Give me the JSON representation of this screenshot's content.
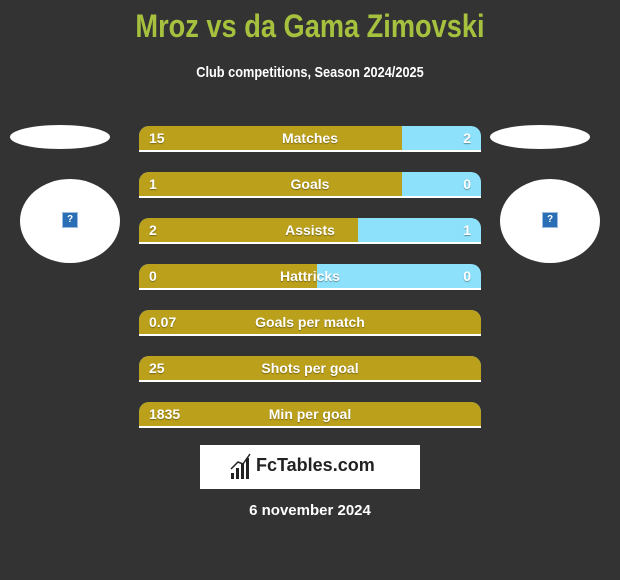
{
  "header": {
    "title": "Mroz vs da Gama Zimovski",
    "subtitle": "Club competitions, Season 2024/2025"
  },
  "players": {
    "left": {
      "name": "Mroz",
      "avatar_icon": "question-mark-icon"
    },
    "right": {
      "name": "da Gama Zimovski",
      "avatar_icon": "question-mark-icon"
    }
  },
  "colors": {
    "left_bar": "#bba01b",
    "right_bar": "#8de1fb",
    "title": "#a6c13e",
    "background": "#333333"
  },
  "stats": [
    {
      "label": "Matches",
      "left": "15",
      "right": "2",
      "left_share": 0.77
    },
    {
      "label": "Goals",
      "left": "1",
      "right": "0",
      "left_share": 0.77
    },
    {
      "label": "Assists",
      "left": "2",
      "right": "1",
      "left_share": 0.64
    },
    {
      "label": "Hattricks",
      "left": "0",
      "right": "0",
      "left_share": 0.52
    },
    {
      "label": "Goals per match",
      "left": "0.07",
      "right": "",
      "left_share": 1.0
    },
    {
      "label": "Shots per goal",
      "left": "25",
      "right": "",
      "left_share": 1.0
    },
    {
      "label": "Min per goal",
      "left": "1835",
      "right": "",
      "left_share": 1.0
    }
  ],
  "footer": {
    "logo_text": "FcTables.com",
    "date": "6 november 2024"
  }
}
